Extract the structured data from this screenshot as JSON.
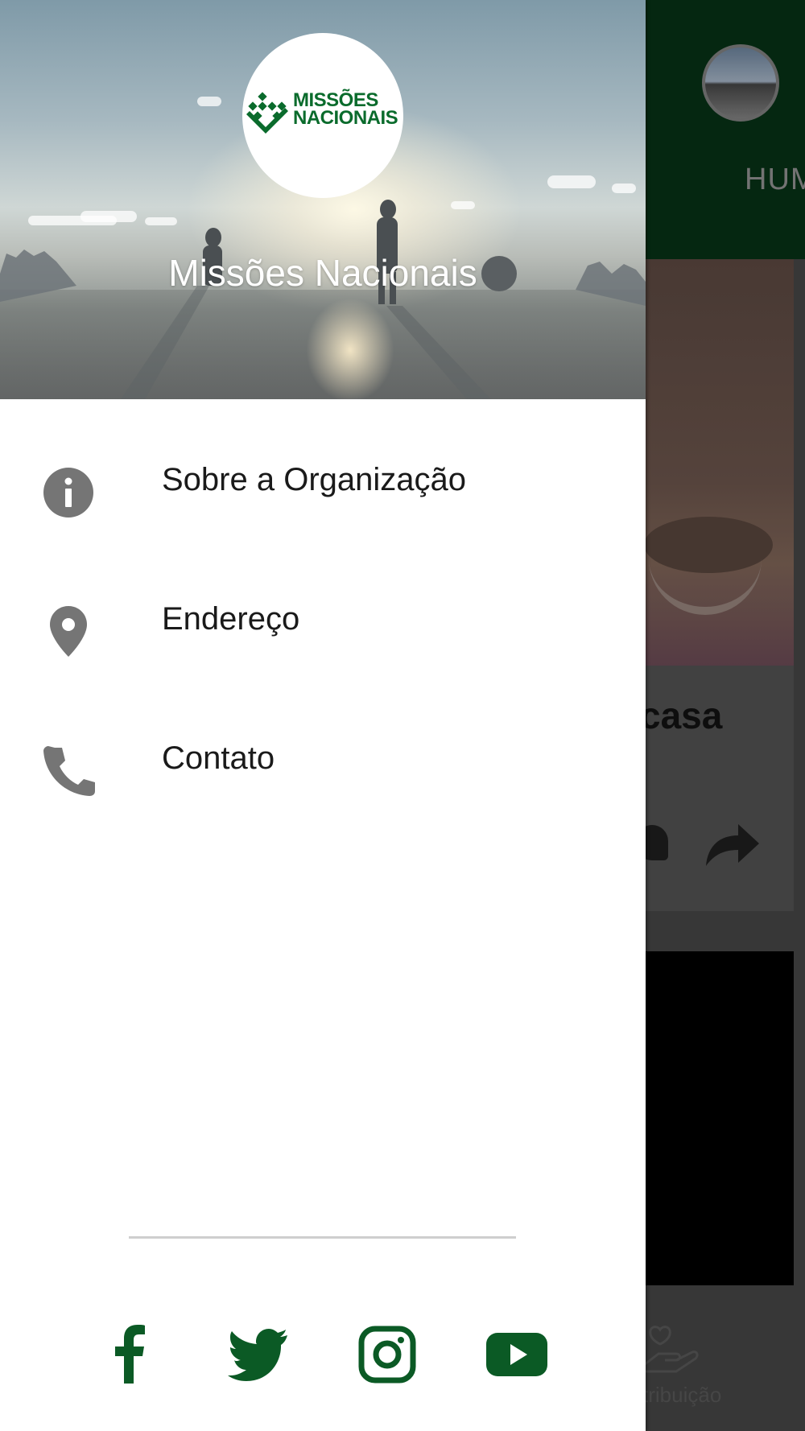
{
  "drawer": {
    "logo": {
      "line1": "MISSÕES",
      "line2": "NACIONAIS",
      "color": "#0a6b2c"
    },
    "org_name": "Missões Nacionais",
    "menu": [
      {
        "label": "Sobre a Organização",
        "icon": "info-icon"
      },
      {
        "label": "Endereço",
        "icon": "location-pin-icon"
      },
      {
        "label": "Contato",
        "icon": "phone-icon"
      }
    ],
    "social": [
      {
        "name": "facebook",
        "icon": "facebook-icon"
      },
      {
        "name": "twitter",
        "icon": "twitter-icon"
      },
      {
        "name": "instagram",
        "icon": "instagram-icon"
      },
      {
        "name": "youtube",
        "icon": "youtube-icon"
      }
    ],
    "social_color": "#0b5a25",
    "icon_color": "#757575"
  },
  "background_app": {
    "tab_label": "HUM",
    "card_title": "casa",
    "bottom_nav_label": "tribuição",
    "header_color": "#062a12"
  }
}
